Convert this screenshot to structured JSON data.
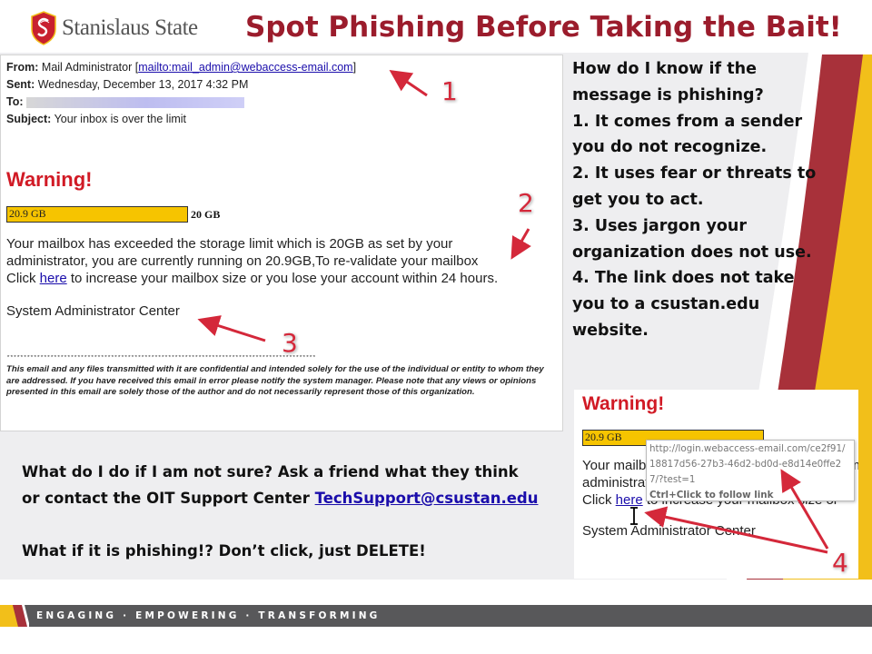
{
  "header": {
    "logo_text": "Stanislaus State",
    "title": "Spot Phishing Before Taking the Bait!"
  },
  "email": {
    "from_label": "From:",
    "from_name": "Mail Administrator",
    "from_link": "mailto:mail_admin@webaccess-email.com",
    "sent_label": "Sent:",
    "sent_value": "Wednesday, December 13, 2017 4:32 PM",
    "to_label": "To:",
    "subject_label": "Subject:",
    "subject_value": "Your inbox is over the limit",
    "warning": "Warning!",
    "usage_label": "20.9 GB",
    "limit_label": "20 GB",
    "body_line1": "Your mailbox has exceeded the storage limit which is 20GB as set by your",
    "body_line2": "administrator, you are currently running on 20.9GB,To re-validate your mailbox",
    "body_line3_pre": "Click ",
    "body_link": "here",
    "body_line3_post": " to increase your mailbox size or you lose your account within 24 hours.",
    "signature": "System Administrator Center",
    "stars": "************************************************************************************************************",
    "disclaimer": "This email and any files transmitted with it are confidential and intended solely for the use of the individual or entity to whom they are addressed. If you have received this email in error please notify the system manager. Please note that any views or opinions presented in this email are solely those of the author and do not necessarily represent those of this organization."
  },
  "tips": {
    "lines": [
      "How do I know if the",
      "message is phishing?",
      "1. It comes from a sender",
      "you do not recognize.",
      "2. It uses fear or threats to",
      "get you to act.",
      "3. Uses jargon your",
      "organization does not use.",
      "4. The link does not take",
      "you to a csustan.edu",
      "website."
    ]
  },
  "advice": {
    "line1": "What do I do if I am not sure? Ask a friend what they think",
    "line2_pre": "or contact the OIT Support Center ",
    "line2_link": "TechSupport@csustan.edu",
    "line3": "What if it is phishing!? Don’t click, just DELETE!"
  },
  "inset": {
    "warning": "Warning!",
    "usage_label": "20.9 GB",
    "body_line1": "Your mailbox has exceeded the storage limit m",
    "body_line2": "administrator, you are currently running on",
    "body_line3_pre": "Click ",
    "body_link": "here",
    "body_line3_post": " to increase your mailbox size or",
    "signature": "System Administrator Center",
    "tooltip_url1": "http://login.webaccess-email.com/ce2f91/",
    "tooltip_url2": "18817d56-27b3-46d2-bd0d-e8d14e0ffe2",
    "tooltip_url3": "7/?test=1",
    "tooltip_hint": "Ctrl+Click to follow link"
  },
  "annotations": {
    "n1": "1",
    "n2": "2",
    "n3": "3",
    "n4": "4"
  },
  "footer": {
    "tagline": "ENGAGING · EMPOWERING · TRANSFORMING"
  },
  "colors": {
    "brand_red": "#9b1c2c",
    "warning_red": "#d11a25",
    "gold": "#f2bf1a",
    "footer_grey": "#58585a",
    "link_blue": "#1a0dab"
  }
}
